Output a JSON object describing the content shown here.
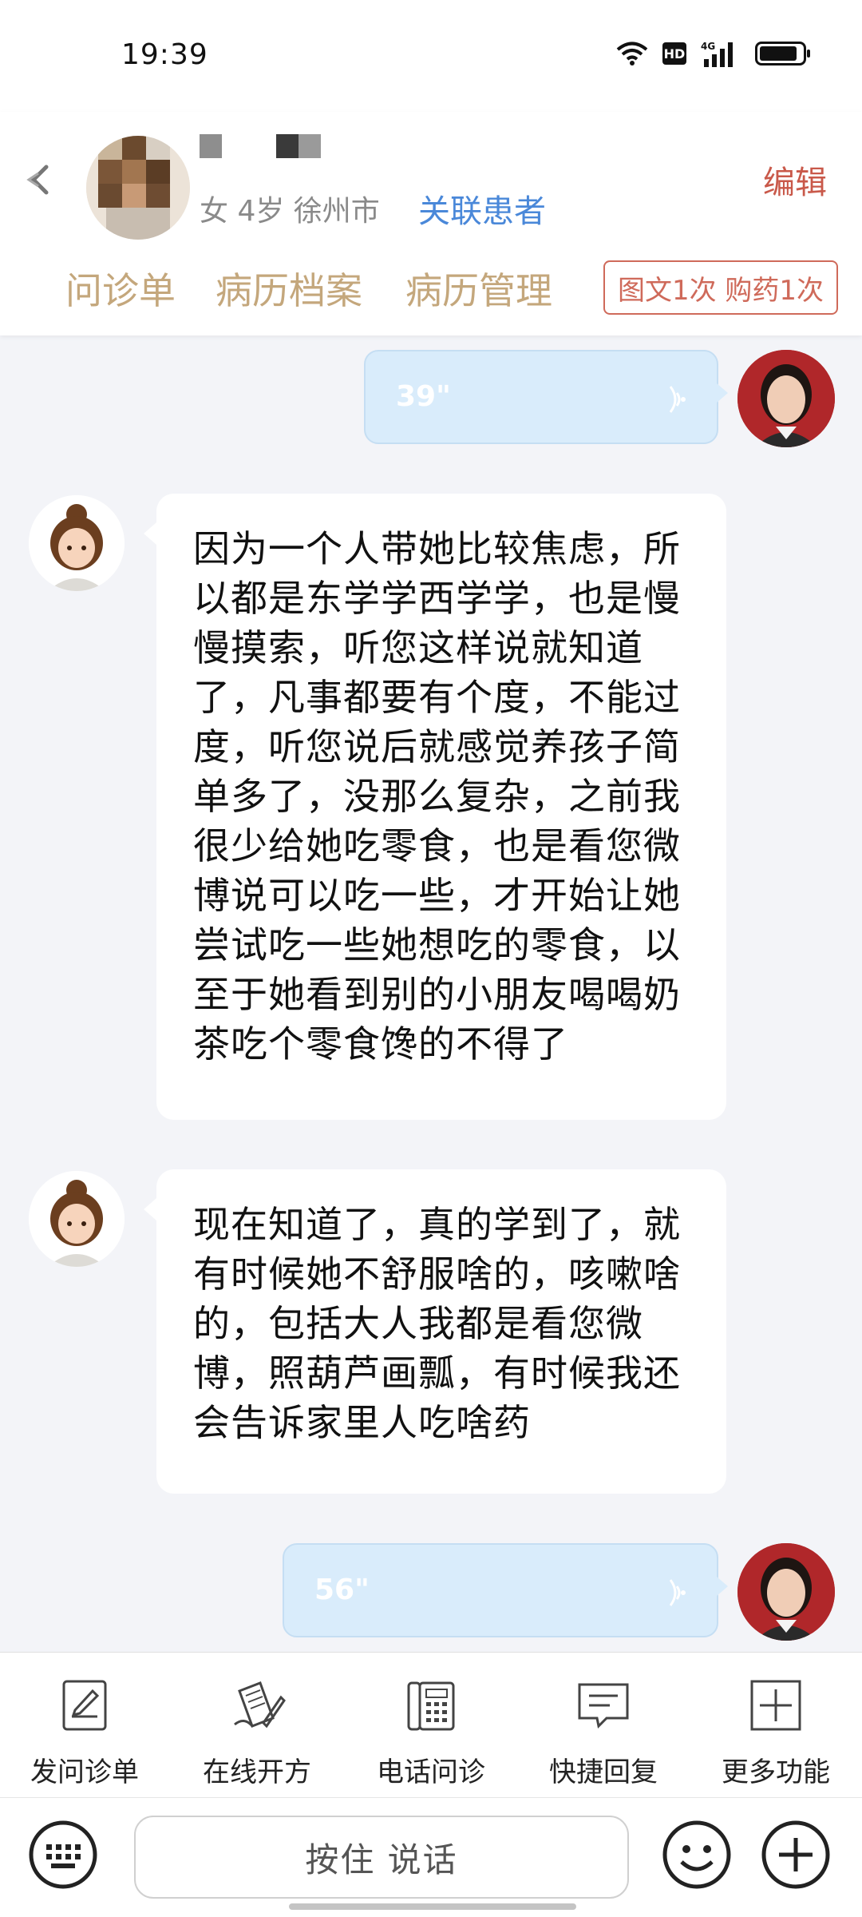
{
  "status_bar": {
    "time": "19:39",
    "hd": "HD"
  },
  "header": {
    "patient_info": "女 4岁   徐州市",
    "link_patient": "关联患者",
    "edit": "编辑",
    "tabs": [
      {
        "label": "问诊单"
      },
      {
        "label": "病历档案"
      },
      {
        "label": "病历管理"
      }
    ],
    "quota": "图文1次 购药1次"
  },
  "messages": [
    {
      "type": "voice",
      "from": "doctor",
      "duration": "39\""
    },
    {
      "type": "text",
      "from": "patient",
      "text": "因为一个人带她比较焦虑，所以都是东学学西学学，也是慢慢摸索，听您这样说就知道了，凡事都要有个度，不能过度，听您说后就感觉养孩子简单多了，没那么复杂，之前我很少给她吃零食，也是看您微博说可以吃一些，才开始让她尝试吃一些她想吃的零食，以至于她看到别的小朋友喝喝奶茶吃个零食馋的不得了"
    },
    {
      "type": "text",
      "from": "patient",
      "text": "现在知道了，真的学到了，就有时候她不舒服啥的，咳嗽啥的，包括大人我都是看您微博，照葫芦画瓢，有时候我还会告诉家里人吃啥药"
    },
    {
      "type": "voice",
      "from": "doctor",
      "duration": "56\""
    }
  ],
  "toolbar": {
    "items": [
      {
        "label": "发问诊单",
        "icon": "form-edit-icon"
      },
      {
        "label": "在线开方",
        "icon": "prescription-icon"
      },
      {
        "label": "电话问诊",
        "icon": "phone-icon"
      },
      {
        "label": "快捷回复",
        "icon": "quick-reply-icon"
      },
      {
        "label": "更多功能",
        "icon": "more-icon"
      }
    ]
  },
  "input": {
    "hold_to_talk": "按住 说话"
  }
}
